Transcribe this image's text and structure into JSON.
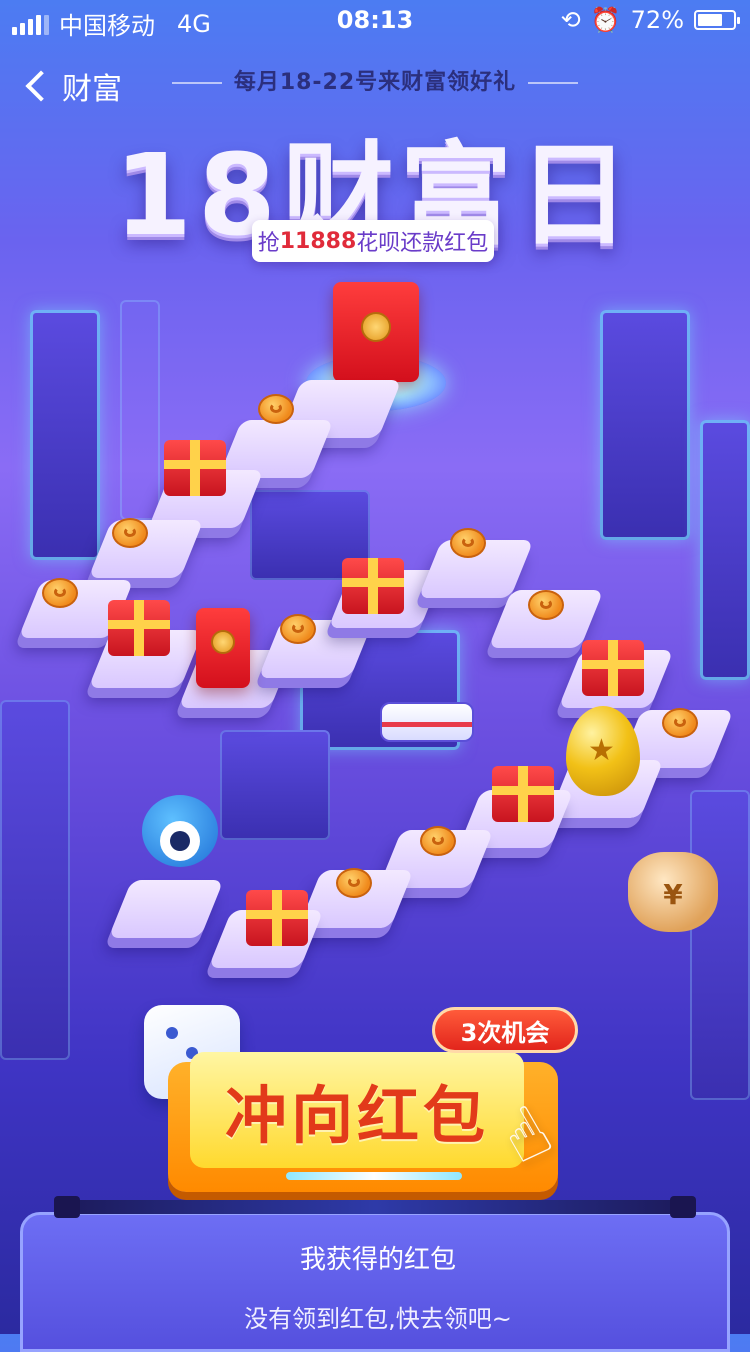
{
  "status_bar": {
    "carrier": "中国移动",
    "network": "4G",
    "time": "08:13",
    "battery_percent": "72%",
    "battery_level": 0.72,
    "icons": [
      "signal-icon",
      "rotation-lock-icon",
      "alarm-icon",
      "battery-icon"
    ]
  },
  "nav": {
    "back_label": "财富"
  },
  "hero": {
    "promo_subtitle": "每月18-22号来财富领好礼",
    "title": "18财富日",
    "reward_prefix": "抢",
    "reward_amount": "11888",
    "reward_suffix": "花呗还款红包"
  },
  "game": {
    "button_label": "冲向红包",
    "chances_label": "3次机会",
    "board_icons": [
      "coin-icon",
      "gift-box-icon",
      "red-packet-icon",
      "golden-egg-icon",
      "money-bag-icon",
      "train-icon",
      "mascot-icon",
      "dice-icon",
      "pointing-hand-icon"
    ]
  },
  "my_packets": {
    "heading": "我获得的红包",
    "empty_message": "没有领到红包,快去领吧~"
  },
  "colors": {
    "accent_red": "#e02b3a",
    "button_yellow": "#ffd92e",
    "button_orange": "#ff8a00"
  }
}
